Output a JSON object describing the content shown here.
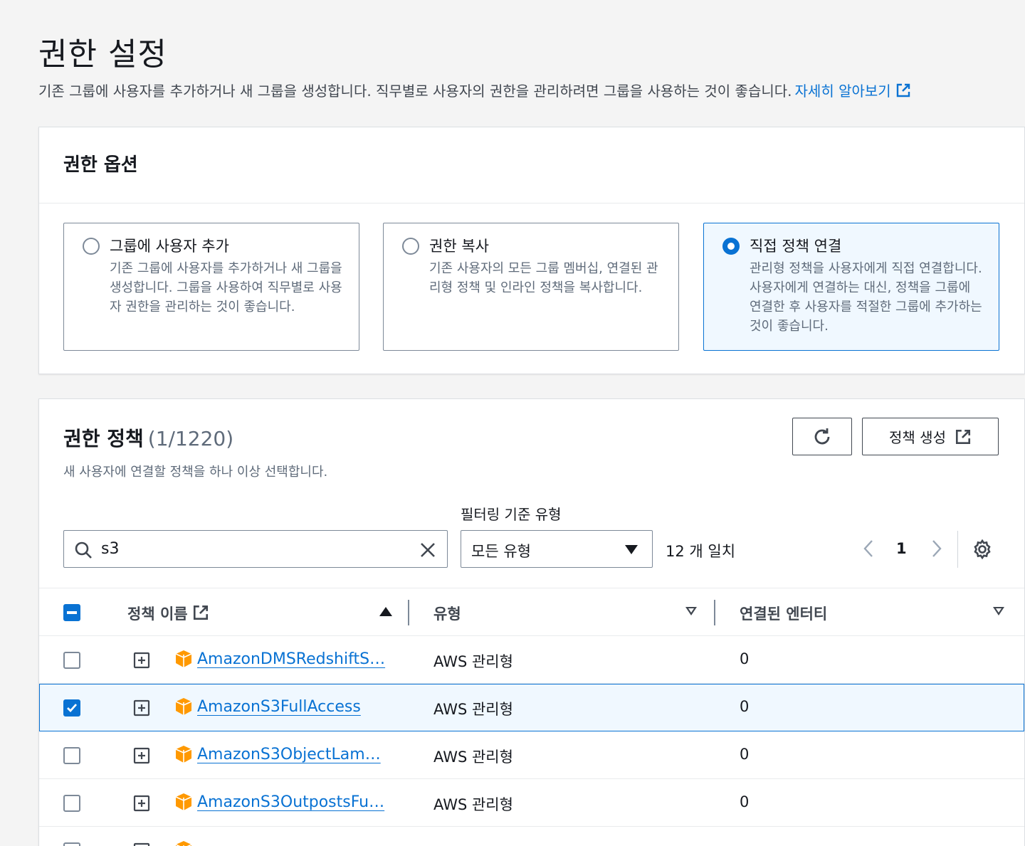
{
  "page": {
    "title": "권한 설정",
    "description": "기존 그룹에 사용자를 추가하거나 새 그룹을 생성합니다. 직무별로 사용자의 권한을 관리하려면 그룹을 사용하는 것이 좋습니다.",
    "learn_more": "자세히 알아보기"
  },
  "options_panel": {
    "title": "권한 옵션",
    "options": [
      {
        "title": "그룹에 사용자 추가",
        "description": "기존 그룹에 사용자를 추가하거나 새 그룹을 생성합니다. 그룹을 사용하여 직무별로 사용자 권한을 관리하는 것이 좋습니다.",
        "selected": false
      },
      {
        "title": "권한 복사",
        "description": "기존 사용자의 모든 그룹 멤버십, 연결된 관리형 정책 및 인라인 정책을 복사합니다.",
        "selected": false
      },
      {
        "title": "직접 정책 연결",
        "description": "관리형 정책을 사용자에게 직접 연결합니다. 사용자에게 연결하는 대신, 정책을 그룹에 연결한 후 사용자를 적절한 그룹에 추가하는 것이 좋습니다.",
        "selected": true
      }
    ]
  },
  "policies_panel": {
    "title": "권한 정책",
    "count": "(1/1220)",
    "description": "새 사용자에 연결할 정책을 하나 이상 선택합니다.",
    "create_button": "정책 생성",
    "filter_label": "필터링 기준 유형",
    "search_value": "s3",
    "filter_value": "모든 유형",
    "match_count": "12 개 일치",
    "page_number": "1",
    "columns": {
      "name": "정책 이름",
      "type": "유형",
      "entities": "연결된 엔터티"
    },
    "rows": [
      {
        "name": "AmazonDMSRedshiftS…",
        "type": "AWS 관리형",
        "entities": "0",
        "checked": false
      },
      {
        "name": "AmazonS3FullAccess",
        "type": "AWS 관리형",
        "entities": "0",
        "checked": true
      },
      {
        "name": "AmazonS3ObjectLam…",
        "type": "AWS 관리형",
        "entities": "0",
        "checked": false
      },
      {
        "name": "AmazonS3OutpostsFu…",
        "type": "AWS 관리형",
        "entities": "0",
        "checked": false
      }
    ]
  },
  "colors": {
    "accent": "#0972d3",
    "policy_icon": "#ff9900"
  }
}
